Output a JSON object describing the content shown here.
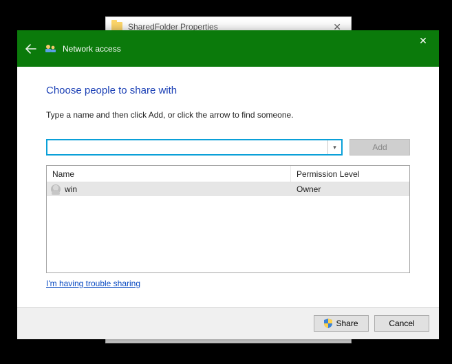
{
  "back_window": {
    "title": "SharedFolder Properties"
  },
  "dialog": {
    "header_title": "Network access",
    "heading": "Choose people to share with",
    "instruction": "Type a name and then click Add, or click the arrow to find someone.",
    "name_input_value": "",
    "add_label": "Add",
    "columns": {
      "name": "Name",
      "perm": "Permission Level"
    },
    "rows": [
      {
        "name": "win",
        "perm": "Owner"
      }
    ],
    "trouble_link": "I'm having trouble sharing",
    "share_label": "Share",
    "cancel_label": "Cancel"
  }
}
